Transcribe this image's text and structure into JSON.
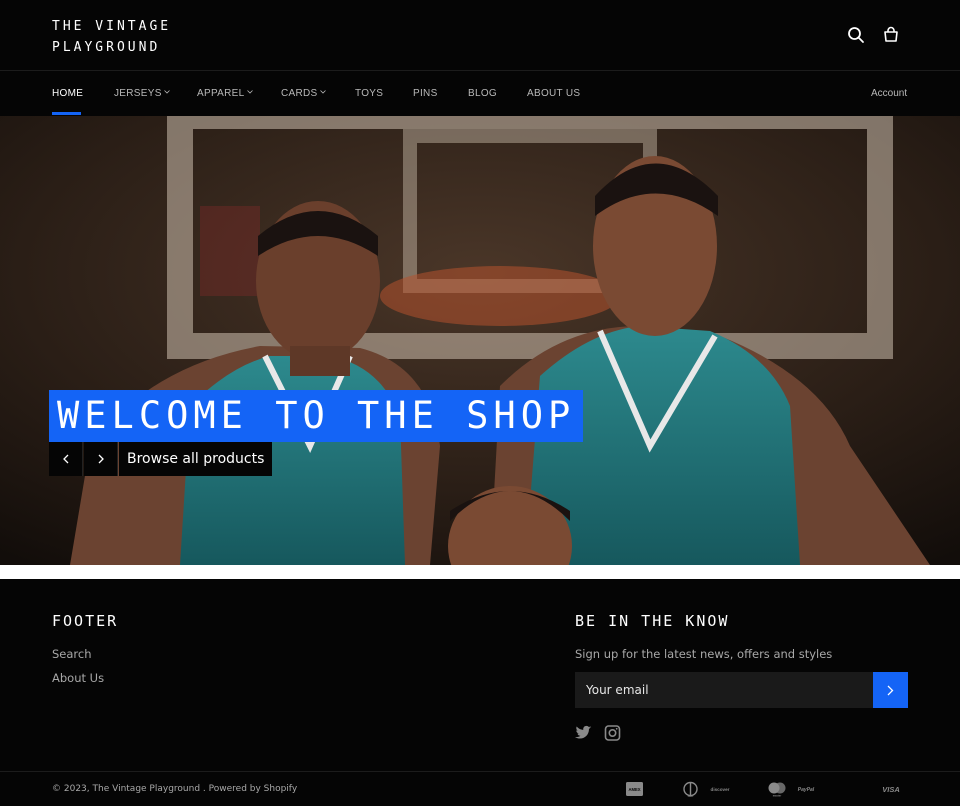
{
  "header": {
    "logo": "THE VINTAGE\nPLAYGROUND"
  },
  "nav": {
    "items": [
      {
        "label": "HOME",
        "active": true,
        "dropdown": false
      },
      {
        "label": "JERSEYS",
        "dropdown": true
      },
      {
        "label": "APPAREL",
        "dropdown": true
      },
      {
        "label": "CARDS",
        "dropdown": true
      },
      {
        "label": "TOYS",
        "dropdown": false
      },
      {
        "label": "PINS",
        "dropdown": false
      },
      {
        "label": "BLOG",
        "dropdown": false
      },
      {
        "label": "ABOUT US",
        "dropdown": false
      }
    ],
    "account": "Account"
  },
  "hero": {
    "title": "WELCOME TO THE SHOP",
    "cta": "Browse all products"
  },
  "footer": {
    "heading": "FOOTER",
    "links": [
      "Search",
      "About Us"
    ],
    "newsletter_heading": "BE IN THE KNOW",
    "newsletter_sub": "Sign up for the latest news, offers and styles",
    "email_placeholder": "Your email",
    "copyright_prefix": "© 2023,",
    "store_name": "The Vintage Playground",
    "powered": ". Powered by Shopify",
    "payments": [
      "AMEX",
      "diners",
      "discover",
      "master",
      "PayPal",
      "VISA"
    ]
  },
  "colors": {
    "accent": "#1464f6",
    "background": "#050505"
  }
}
